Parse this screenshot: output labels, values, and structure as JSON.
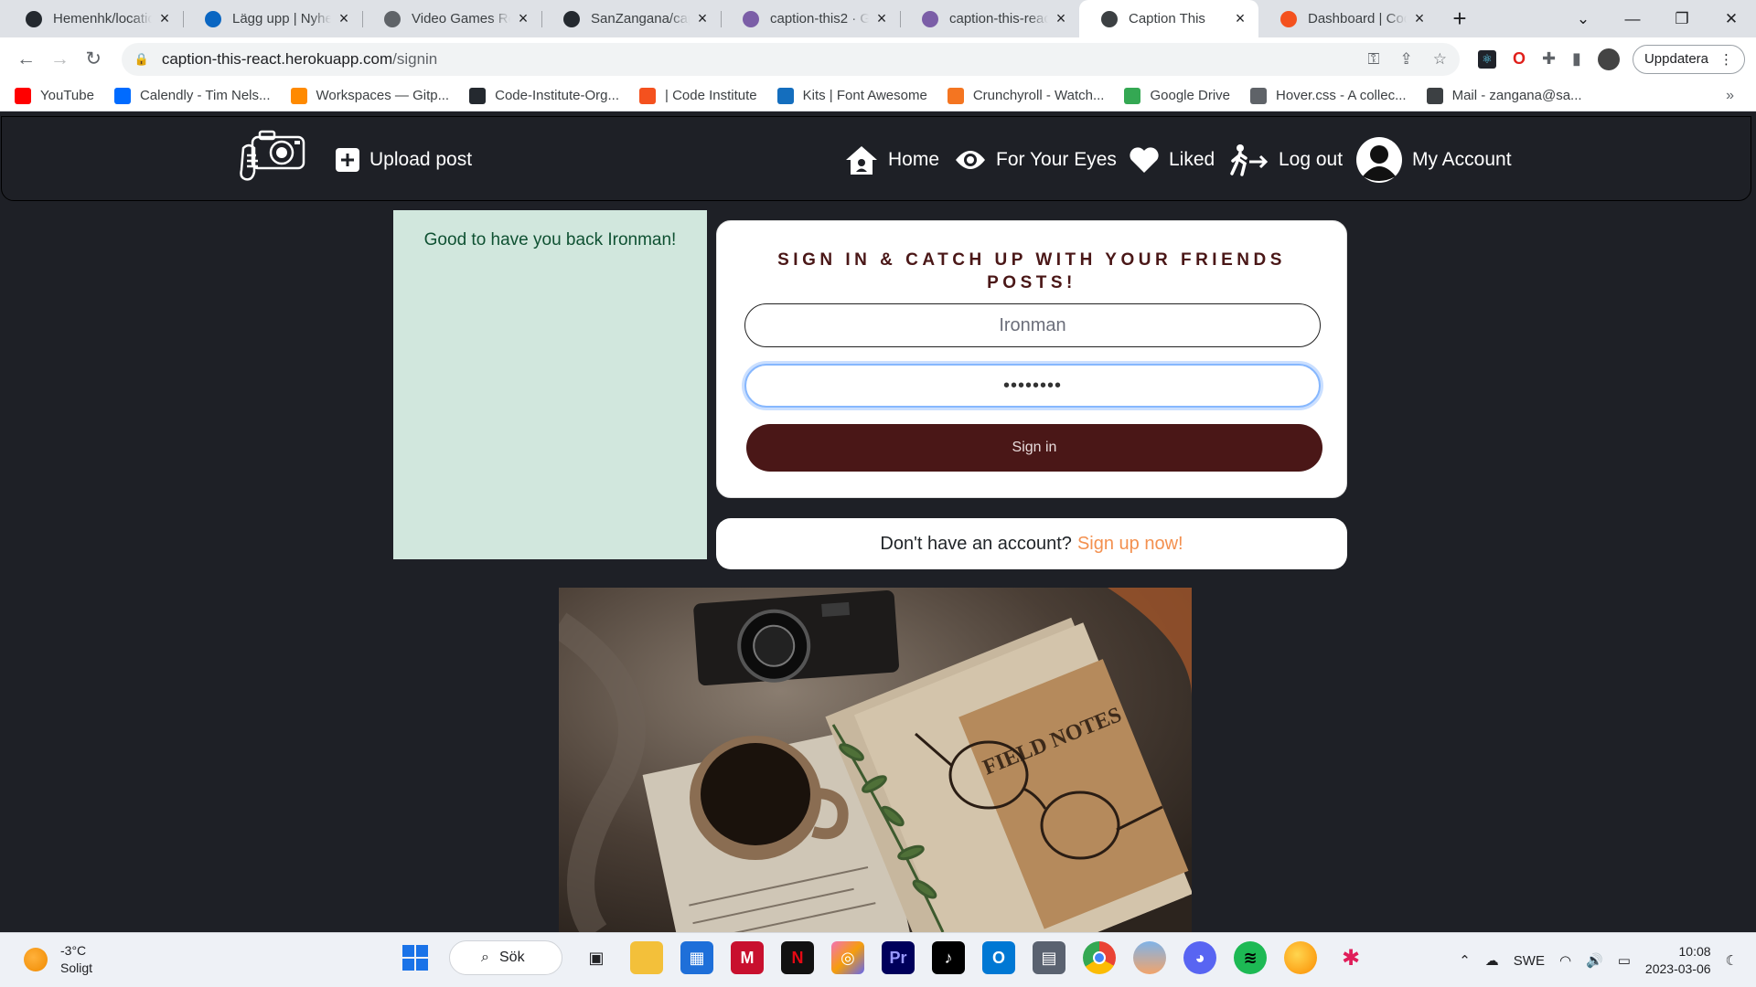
{
  "browser": {
    "tabs": [
      {
        "title": "Hemenhk/location",
        "icon": "github-icon",
        "color": "#24292f"
      },
      {
        "title": "Lägg upp | Nyheter",
        "icon": "linkedin-icon",
        "color": "#0a66c2"
      },
      {
        "title": "Video Games Reviews",
        "icon": "globe-icon",
        "color": "#5f6368"
      },
      {
        "title": "SanZangana/caption",
        "icon": "github-icon",
        "color": "#24292f"
      },
      {
        "title": "caption-this2 · GitHub",
        "icon": "heroku-icon",
        "color": "#7b5ea7"
      },
      {
        "title": "caption-this-react",
        "icon": "heroku-icon",
        "color": "#7b5ea7"
      },
      {
        "title": "Caption This",
        "icon": "camera-icon",
        "color": "#3c4043",
        "active": true
      },
      {
        "title": "Dashboard | Code",
        "icon": "code-institute-icon",
        "color": "#f4511e"
      }
    ],
    "url_host": "caption-this-react.herokuapp.com",
    "url_path": "/signin",
    "update_label": "Uppdatera",
    "bookmarks": [
      {
        "label": "YouTube",
        "icon": "youtube-icon",
        "color": "#ff0000"
      },
      {
        "label": "Calendly - Tim Nels...",
        "icon": "calendly-icon",
        "color": "#006bff"
      },
      {
        "label": "Workspaces — Gitp...",
        "icon": "gitpod-icon",
        "color": "#ff8a00"
      },
      {
        "label": "Code-Institute-Org...",
        "icon": "github-icon",
        "color": "#24292f"
      },
      {
        "label": "| Code Institute",
        "icon": "code-institute-icon",
        "color": "#f4511e"
      },
      {
        "label": "Kits | Font Awesome",
        "icon": "flag-icon",
        "color": "#146ebe"
      },
      {
        "label": "Crunchyroll - Watch...",
        "icon": "crunchyroll-icon",
        "color": "#f47521"
      },
      {
        "label": "Google Drive",
        "icon": "google-drive-icon",
        "color": "#34a853"
      },
      {
        "label": "Hover.css - A collec...",
        "icon": "globe-icon",
        "color": "#5f6368"
      },
      {
        "label": "Mail - zangana@sa...",
        "icon": "mail-icon",
        "color": "#3c4043"
      }
    ]
  },
  "site": {
    "nav": {
      "upload": "Upload post",
      "home": "Home",
      "for_your_eyes": "For Your Eyes",
      "liked": "Liked",
      "logout": "Log out",
      "account": "My Account"
    },
    "alert": "Good to have you back Ironman!",
    "signin": {
      "heading": "SIGN IN & CATCH UP WITH YOUR FRIENDS POSTS!",
      "username": "Ironman",
      "password": "••••••••",
      "button": "Sign in"
    },
    "signup": {
      "text": "Don't have an account?",
      "link": "Sign up now!"
    },
    "hero_text": "FIELD NOTES"
  },
  "taskbar": {
    "temp": "-3°C",
    "condition": "Soligt",
    "search": "Sök",
    "lang": "SWE",
    "time": "10:08",
    "date": "2023-03-06"
  }
}
